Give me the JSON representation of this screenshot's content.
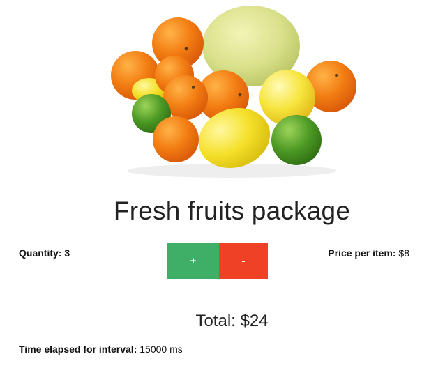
{
  "product": {
    "image_alt": "Assorted citrus fruits",
    "title": "Fresh fruits package"
  },
  "quantity": {
    "label": "Quantity:",
    "value": "3"
  },
  "buttons": {
    "increment_label": "+",
    "decrement_label": "-"
  },
  "price": {
    "label": "Price per item:",
    "value": "$8"
  },
  "total": {
    "text": "Total: $24"
  },
  "timer": {
    "label": "Time elapsed for interval:",
    "value": "15000 ms"
  },
  "colors": {
    "increment": "#3fae67",
    "decrement": "#ee4125"
  }
}
